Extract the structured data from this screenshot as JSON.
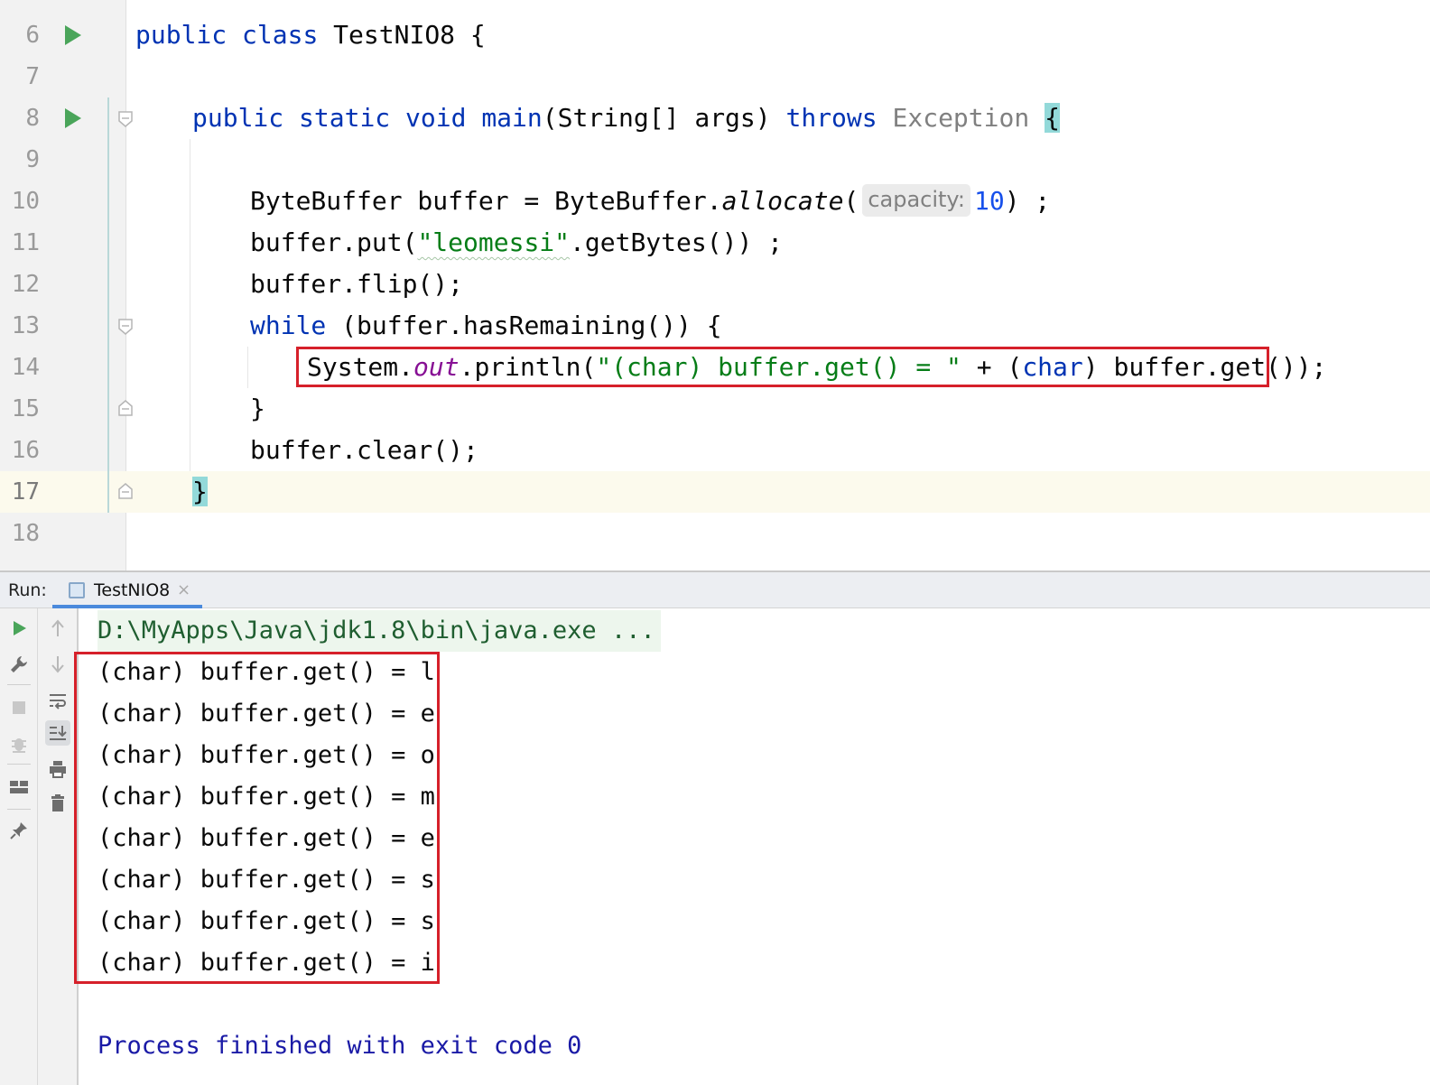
{
  "editor": {
    "line_numbers": [
      "6",
      "7",
      "8",
      "9",
      "10",
      "11",
      "12",
      "13",
      "14",
      "15",
      "16",
      "17",
      "18"
    ],
    "code": {
      "l6_kw1": "public",
      "l6_kw2": "class",
      "l6_rest": " TestNIO8 {",
      "l8_kw1": "public",
      "l8_kw2": "static",
      "l8_kw3": "void",
      "l8_fn": "main",
      "l8_params": "(String[] args) ",
      "l8_throws": "throws",
      "l8_exc": "Exception",
      "l8_brace": "{",
      "l10_a": "ByteBuffer buffer = ByteBuffer.",
      "l10_fn": "allocate",
      "l10_open": "(",
      "l10_hint": "capacity:",
      "l10_num": "10",
      "l10_close": ") ;",
      "l11_a": "buffer.put(",
      "l11_str": "\"leomessi\"",
      "l11_b": ".getBytes()) ;",
      "l12": "buffer.flip();",
      "l13_kw": "while",
      "l13_rest": " (buffer.hasRemaining()) {",
      "l14_a": "System.",
      "l14_field": "out",
      "l14_b": ".println(",
      "l14_str": "\"(char) buffer.get() = \"",
      "l14_c": " + (",
      "l14_kw": "char",
      "l14_d": ") buffer.get());",
      "l15": "}",
      "l16": "buffer.clear();",
      "l17": "}"
    }
  },
  "run_panel": {
    "label": "Run:",
    "tab_name": "TestNIO8",
    "tab_close": "×"
  },
  "console": {
    "command": "D:\\MyApps\\Java\\jdk1.8\\bin\\java.exe ...",
    "output_lines": [
      "(char) buffer.get() = l",
      "(char) buffer.get() = e",
      "(char) buffer.get() = o",
      "(char) buffer.get() = m",
      "(char) buffer.get() = e",
      "(char) buffer.get() = s",
      "(char) buffer.get() = s",
      "(char) buffer.get() = i"
    ],
    "exit_message": "Process finished with exit code 0"
  },
  "icons": {
    "gutter": [
      "run-arrow-icon",
      "fold-icon"
    ],
    "left_toolbar": [
      "rerun-icon",
      "wrench-icon",
      "stop-icon",
      "debug-icon",
      "layout-icon",
      "pin-icon"
    ],
    "right_toolbar": [
      "up-arrow-icon",
      "down-arrow-icon",
      "soft-wrap-icon",
      "scroll-to-end-icon",
      "print-icon",
      "trash-icon"
    ]
  },
  "colors": {
    "keyword": "#0033b3",
    "string": "#067d17",
    "number": "#1750eb",
    "highlight_box": "#d6202a",
    "exit_message": "#1a1aa6"
  }
}
